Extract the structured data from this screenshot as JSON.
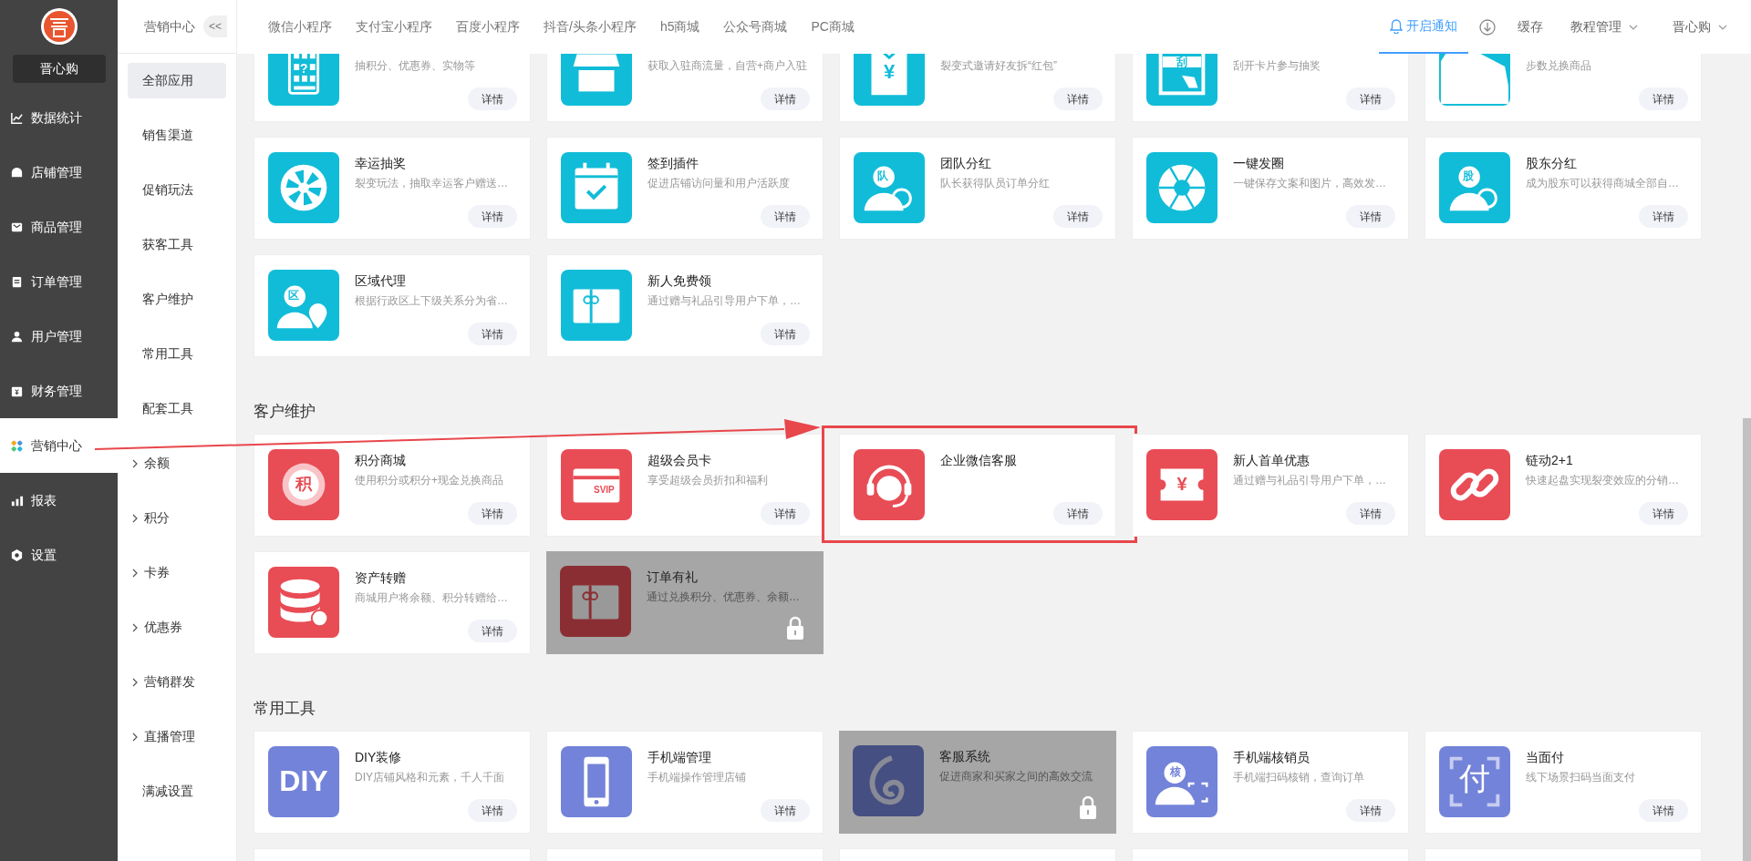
{
  "sidebar": {
    "store_name": "晋心购",
    "items": [
      {
        "label": "数据统计",
        "selected": false
      },
      {
        "label": "店铺管理",
        "selected": false
      },
      {
        "label": "商品管理",
        "selected": false
      },
      {
        "label": "订单管理",
        "selected": false
      },
      {
        "label": "用户管理",
        "selected": false
      },
      {
        "label": "财务管理",
        "selected": false
      },
      {
        "label": "营销中心",
        "selected": true
      },
      {
        "label": "报表",
        "selected": false
      },
      {
        "label": "设置",
        "selected": false
      }
    ]
  },
  "subnav": {
    "title": "营销中心",
    "collapse": "<<",
    "items": [
      {
        "label": "全部应用",
        "selected": true,
        "kind": "link"
      },
      {
        "label": "销售渠道",
        "selected": false,
        "kind": "link"
      },
      {
        "label": "促销玩法",
        "selected": false,
        "kind": "link"
      },
      {
        "label": "获客工具",
        "selected": false,
        "kind": "link"
      },
      {
        "label": "客户维护",
        "selected": false,
        "kind": "link"
      },
      {
        "label": "常用工具",
        "selected": false,
        "kind": "link"
      },
      {
        "label": "配套工具",
        "selected": false,
        "kind": "link"
      },
      {
        "label": "余额",
        "selected": false,
        "kind": "group",
        "expanded": false
      },
      {
        "label": "积分",
        "selected": false,
        "kind": "group",
        "expanded": false
      },
      {
        "label": "卡券",
        "selected": false,
        "kind": "group",
        "expanded": false
      },
      {
        "label": "优惠券",
        "selected": false,
        "kind": "group",
        "expanded": false
      },
      {
        "label": "营销群发",
        "selected": false,
        "kind": "group",
        "expanded": false
      },
      {
        "label": "直播管理",
        "selected": false,
        "kind": "group",
        "expanded": false
      },
      {
        "label": "满减设置",
        "selected": false,
        "kind": "link"
      }
    ]
  },
  "top_tabs": [
    {
      "label": "微信小程序"
    },
    {
      "label": "支付宝小程序"
    },
    {
      "label": "百度小程序"
    },
    {
      "label": "抖音/头条小程序"
    },
    {
      "label": "h5商城"
    },
    {
      "label": "公众号商城"
    },
    {
      "label": "PC商城"
    }
  ],
  "top_right": {
    "notify": {
      "label": "开启通知",
      "selected": true
    },
    "cache": "缓存",
    "tutorial": "教程管理",
    "user": "晋心购"
  },
  "sections": [
    {
      "color": "#11bcd8",
      "cards": [
        {
          "kind": "app",
          "desc": "抽积分、优惠券、实物等",
          "button": "详情",
          "locked": false,
          "highlighted": false,
          "icon_text": "?"
        },
        {
          "kind": "app",
          "desc": "获取入驻商流量，自营+商户入驻",
          "button": "详情",
          "locked": false,
          "highlighted": false
        },
        {
          "kind": "app",
          "desc": "裂变式邀请好友拆“红包”",
          "button": "详情",
          "locked": false,
          "highlighted": false,
          "icon_text": "¥"
        },
        {
          "kind": "app",
          "desc": "刮开卡片参与抽奖",
          "button": "详情",
          "locked": false,
          "highlighted": false,
          "icon_text": "刮"
        },
        {
          "kind": "app",
          "desc": "步数兑换商品",
          "button": "详情",
          "locked": false,
          "highlighted": false
        },
        {
          "kind": "app",
          "title": "幸运抽奖",
          "desc": "裂变玩法，抽取幸运客户赠送…",
          "button": "详情",
          "locked": false,
          "highlighted": false
        },
        {
          "kind": "app",
          "title": "签到插件",
          "desc": "促进店铺访问量和用户活跃度",
          "button": "详情",
          "locked": false,
          "highlighted": false
        },
        {
          "kind": "app",
          "title": "团队分红",
          "desc": "队长获得队员订单分红",
          "button": "详情",
          "locked": false,
          "highlighted": false,
          "icon_text": "队"
        },
        {
          "kind": "app",
          "title": "一键发圈",
          "desc": "一键保存文案和图片，高效发…",
          "button": "详情",
          "locked": false,
          "highlighted": false
        },
        {
          "kind": "app",
          "title": "股东分红",
          "desc": "成为股东可以获得商城全部自…",
          "button": "详情",
          "locked": false,
          "highlighted": false,
          "icon_text": "股"
        },
        {
          "kind": "app",
          "title": "区域代理",
          "desc": "根据行政区上下级关系分为省…",
          "button": "详情",
          "locked": false,
          "highlighted": false,
          "icon_text": "区"
        },
        {
          "kind": "app",
          "title": "新人免费领",
          "desc": "通过赠与礼品引导用户下单，…",
          "button": "详情",
          "locked": false,
          "highlighted": false
        }
      ]
    },
    {
      "title": "客户维护",
      "color": "#e84c55",
      "cards": [
        {
          "kind": "app",
          "title": "积分商城",
          "desc": "使用积分或积分+现金兑换商品",
          "button": "详情",
          "locked": false,
          "highlighted": false,
          "icon_text": "积"
        },
        {
          "kind": "app",
          "title": "超级会员卡",
          "desc": "享受超级会员折扣和福利",
          "button": "详情",
          "locked": false,
          "highlighted": false,
          "icon_text": "SVIP"
        },
        {
          "kind": "app",
          "title": "企业微信客服",
          "button": "详情",
          "locked": false,
          "highlighted": true
        },
        {
          "kind": "app",
          "title": "新人首单优惠",
          "desc": "通过赠与礼品引导用户下单，…",
          "button": "详情",
          "locked": false,
          "highlighted": false,
          "icon_text": "¥"
        },
        {
          "kind": "app",
          "title": "链动2+1",
          "desc": "快速起盘实现裂变效应的分销…",
          "button": "详情",
          "locked": false,
          "highlighted": false
        },
        {
          "kind": "app",
          "title": "资产转赠",
          "desc": "商城用户将余额、积分转赠给…",
          "button": "详情",
          "locked": false,
          "highlighted": false
        },
        {
          "kind": "app",
          "title": "订单有礼",
          "desc": "通过兑换积分、优惠券、余额…",
          "locked": true,
          "highlighted": false
        }
      ]
    },
    {
      "title": "常用工具",
      "color": "#7383d9",
      "cards": [
        {
          "kind": "app",
          "title": "DIY装修",
          "desc": "DIY店铺风格和元素，千人千面",
          "button": "详情",
          "locked": false,
          "highlighted": false,
          "icon_text": "DIY"
        },
        {
          "kind": "app",
          "title": "手机端管理",
          "desc": "手机端操作管理店铺",
          "button": "详情",
          "locked": false,
          "highlighted": false
        },
        {
          "kind": "app",
          "title": "客服系统",
          "desc": "促进商家和买家之间的高效交流",
          "locked": true,
          "highlighted": false
        },
        {
          "kind": "app",
          "title": "手机端核销员",
          "desc": "手机端扫码核销，查询订单",
          "button": "详情",
          "locked": false,
          "highlighted": false,
          "icon_text": "核"
        },
        {
          "kind": "app",
          "title": "当面付",
          "desc": "线下场景扫码当面支付",
          "button": "详情",
          "locked": false,
          "highlighted": false,
          "icon_text": "付"
        },
        {
          "kind": "blank"
        },
        {
          "kind": "blank"
        },
        {
          "kind": "blank"
        },
        {
          "kind": "blank"
        },
        {
          "kind": "blank"
        }
      ]
    }
  ]
}
